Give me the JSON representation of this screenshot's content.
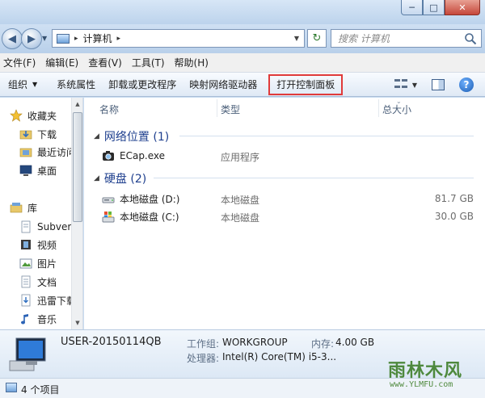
{
  "window": {
    "controls": {
      "minimize": "─",
      "maximize": "□",
      "close": "✕"
    }
  },
  "nav": {
    "back_glyph": "◀",
    "forward_glyph": "▶",
    "address_crumb": "计算机",
    "address_sep_glyph": "▸",
    "refresh_glyph": "↻",
    "search_placeholder": "搜索 计算机"
  },
  "menubar": {
    "items": [
      "文件(F)",
      "编辑(E)",
      "查看(V)",
      "工具(T)",
      "帮助(H)"
    ]
  },
  "toolbar": {
    "organize": "组织",
    "system_properties": "系统属性",
    "uninstall": "卸载或更改程序",
    "map_drive": "映射网络驱动器",
    "open_control_panel": "打开控制面板",
    "highlight_color": "#e03a3a"
  },
  "sidebar": {
    "favorites": "收藏夹",
    "downloads": "下载",
    "recent": "最近访问",
    "desktop": "桌面",
    "libraries": "库",
    "subversion": "Subvers",
    "videos": "视频",
    "pictures": "图片",
    "documents": "文档",
    "xunlei": "迅雷下载",
    "music": "音乐"
  },
  "columns": {
    "name": "名称",
    "type": "类型",
    "total_size": "总大小"
  },
  "groups": {
    "network": {
      "title": "网络位置 (1)",
      "items": [
        {
          "name": "ECap.exe",
          "type": "应用程序",
          "size": ""
        }
      ]
    },
    "disks": {
      "title": "硬盘 (2)",
      "items": [
        {
          "name": "本地磁盘 (D:)",
          "type": "本地磁盘",
          "size": "81.7 GB"
        },
        {
          "name": "本地磁盘 (C:)",
          "type": "本地磁盘",
          "size": "30.0 GB"
        }
      ]
    }
  },
  "details": {
    "computer_name": "USER-20150114QB",
    "workgroup_label": "工作组:",
    "workgroup_value": "WORKGROUP",
    "memory_label": "内存:",
    "memory_value": "4.00 GB",
    "processor_label": "处理器:",
    "processor_value": "Intel(R) Core(TM) i5-3..."
  },
  "status": {
    "items_count": "4 个项目"
  },
  "watermark": {
    "name": "雨林木风",
    "url": "www.YLMFU.com"
  }
}
